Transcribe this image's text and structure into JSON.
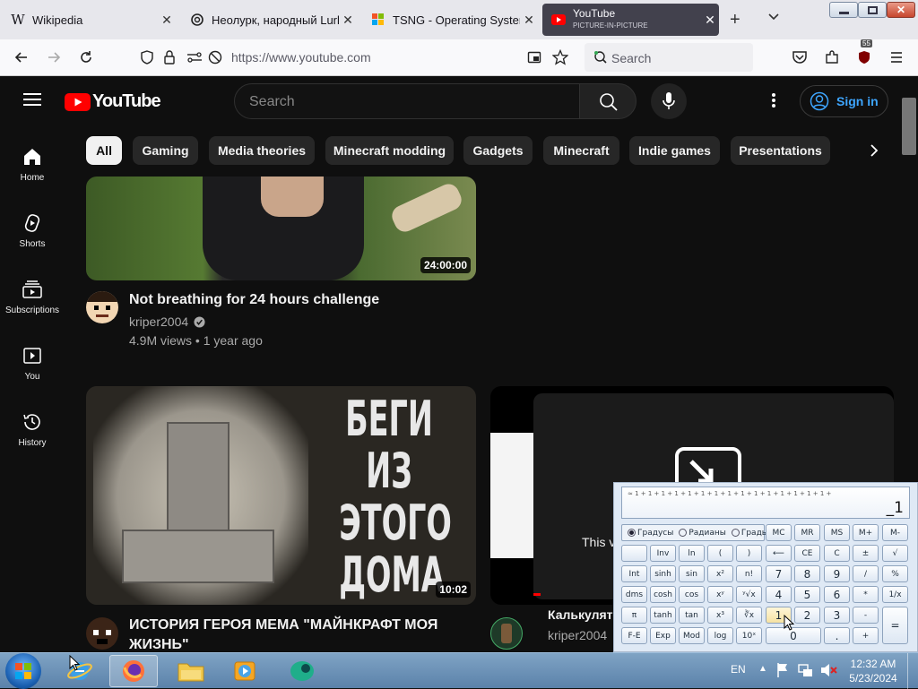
{
  "browser": {
    "tabs": [
      {
        "title": "Wikipedia",
        "icon": "wikipedia-icon"
      },
      {
        "title": "Неолурк, народный Lurkmore",
        "icon": "openai-icon"
      },
      {
        "title": "TSNG - Operating Systems",
        "icon": "windows-flag-icon"
      },
      {
        "title": "YouTube",
        "subtitle": "PICTURE-IN-PICTURE",
        "icon": "youtube-icon"
      }
    ],
    "url": "https://www.youtube.com",
    "search_placeholder": "Search",
    "extensions_badge": "55"
  },
  "youtube": {
    "logo_text": "YouTube",
    "search_placeholder": "Search",
    "sign_in": "Sign in",
    "chips": [
      "All",
      "Gaming",
      "Media theories",
      "Minecraft modding",
      "Gadgets",
      "Minecraft",
      "Indie games",
      "Presentations"
    ],
    "sidebar": [
      {
        "label": "Home",
        "icon": "home-icon"
      },
      {
        "label": "Shorts",
        "icon": "shorts-icon"
      },
      {
        "label": "Subscriptions",
        "icon": "subscriptions-icon"
      },
      {
        "label": "You",
        "icon": "you-icon"
      },
      {
        "label": "History",
        "icon": "history-icon"
      }
    ],
    "videos": [
      {
        "title": "Not breathing for 24 hours challenge",
        "channel": "kriper2004",
        "meta": "4.9M views • 1 year ago",
        "duration": "24:00:00"
      },
      {
        "title": "ИСТОРИЯ ГЕРОЯ МЕМА \"МАЙНКРАФТ МОЯ ЖИЗНЬ\"",
        "duration": "10:02",
        "thumb_text": [
          "БЕГИ",
          "ИЗ ЭТОГО",
          "ДОМА"
        ]
      },
      {
        "title": "Калькулято",
        "channel": "kriper2004",
        "pip_text": "This v"
      }
    ]
  },
  "calculator": {
    "display_history": "≈ 1 + 1 + 1 + 1 + 1 + 1 + 1 + 1 + 1 + 1 + 1 + 1 + 1 + 1 + 1 +",
    "display_value": "_1",
    "radio": [
      "Градусы",
      "Радианы",
      "Грады"
    ],
    "mem": [
      "MC",
      "MR",
      "MS",
      "M+",
      "M-"
    ],
    "rows": [
      [
        "",
        "Inv",
        "ln",
        "(",
        ")",
        "⟵",
        "CE",
        "C",
        "±",
        "√"
      ],
      [
        "Int",
        "sinh",
        "sin",
        "x²",
        "n!",
        "7",
        "8",
        "9",
        "/",
        "%"
      ],
      [
        "dms",
        "cosh",
        "cos",
        "xʸ",
        "ʸ√x",
        "4",
        "5",
        "6",
        "*",
        "1/x"
      ],
      [
        "π",
        "tanh",
        "tan",
        "x³",
        "∛x",
        "1",
        "2",
        "3",
        "-",
        "="
      ],
      [
        "F-E",
        "Exp",
        "Mod",
        "log",
        "10ˣ",
        "0",
        "",
        ".",
        "+",
        ""
      ]
    ]
  },
  "taskbar": {
    "lang": "EN",
    "time": "12:32 AM",
    "date": "5/23/2024"
  },
  "colors": {
    "youtube_red": "#ff0000",
    "signin_blue": "#3ea6ff",
    "chip_active": "#f1f1f1"
  }
}
